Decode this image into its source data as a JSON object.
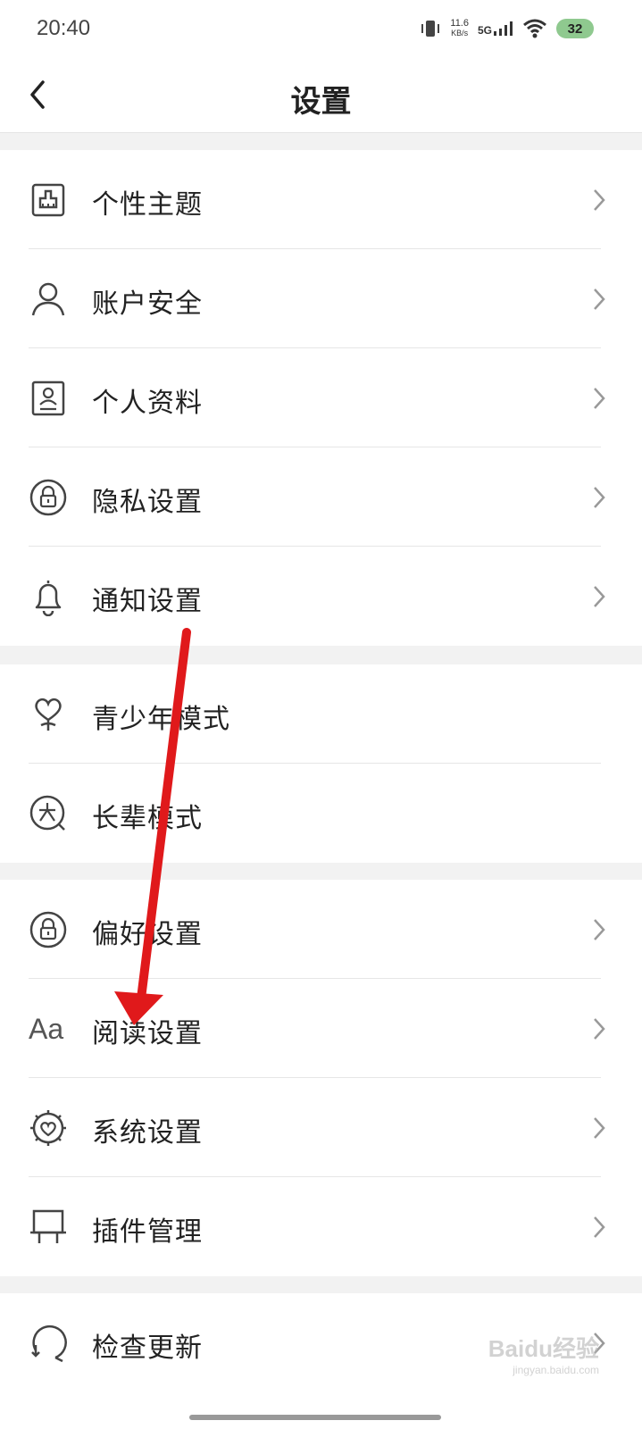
{
  "status_bar": {
    "time": "20:40",
    "net_speed_value": "11.6",
    "net_speed_unit": "KB/s",
    "network": "5G",
    "battery": "32",
    "battery_color": "#8fc98f"
  },
  "header": {
    "title": "设置",
    "back_icon": "chevron-left-icon"
  },
  "groups": [
    {
      "items": [
        {
          "label": "个性主题",
          "icon": "theme-brush-icon"
        },
        {
          "label": "账户安全",
          "icon": "user-icon"
        },
        {
          "label": "个人资料",
          "icon": "profile-card-icon"
        },
        {
          "label": "隐私设置",
          "icon": "lock-icon"
        },
        {
          "label": "通知设置",
          "icon": "bell-icon"
        }
      ]
    },
    {
      "items": [
        {
          "label": "青少年模式",
          "icon": "youth-heart-icon"
        },
        {
          "label": "长辈模式",
          "icon": "elder-mode-icon"
        }
      ]
    },
    {
      "items": [
        {
          "label": "偏好设置",
          "icon": "lock-icon"
        },
        {
          "label": "阅读设置",
          "icon": "text-size-icon",
          "icon_text": "Aa"
        },
        {
          "label": "系统设置",
          "icon": "heart-gear-icon"
        },
        {
          "label": "插件管理",
          "icon": "plugin-board-icon"
        }
      ]
    },
    {
      "items": [
        {
          "label": "检查更新",
          "icon": "update-refresh-icon"
        }
      ]
    }
  ],
  "annotation": {
    "arrow_color": "#e0191b"
  },
  "watermark": {
    "text": "Baidu经验",
    "sub": "jingyan.baidu.com"
  }
}
